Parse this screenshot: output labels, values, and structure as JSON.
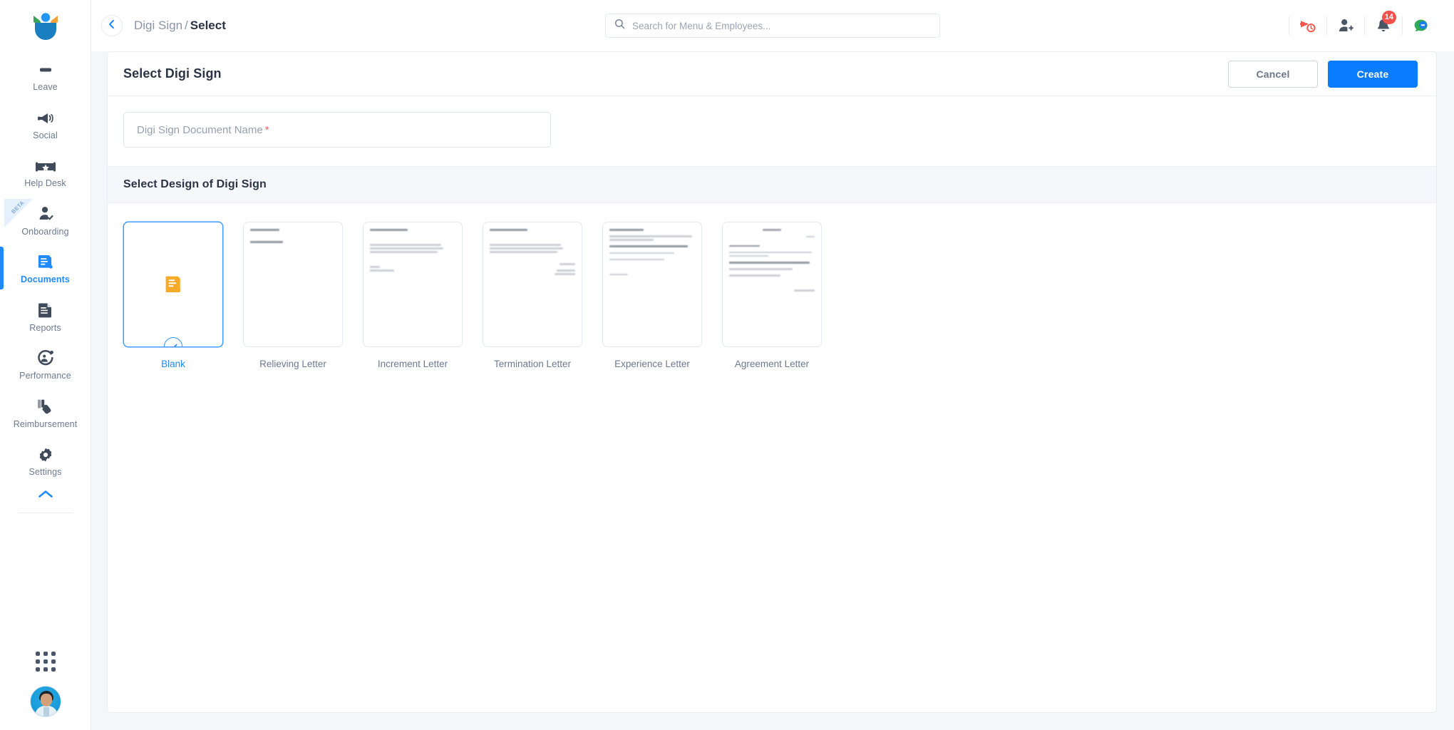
{
  "sidebar": {
    "logo_name": "company-logo",
    "items": [
      {
        "label": "Leave",
        "icon": "leave-icon",
        "active": false,
        "beta": false
      },
      {
        "label": "Social",
        "icon": "megaphone-icon",
        "active": false,
        "beta": false
      },
      {
        "label": "Help Desk",
        "icon": "help-desk-icon",
        "active": false,
        "beta": false
      },
      {
        "label": "Onboarding",
        "icon": "user-check-icon",
        "active": false,
        "beta": true
      },
      {
        "label": "Documents",
        "icon": "document-icon",
        "active": true,
        "beta": false
      },
      {
        "label": "Reports",
        "icon": "reports-icon",
        "active": false,
        "beta": false
      },
      {
        "label": "Performance",
        "icon": "performance-icon",
        "active": false,
        "beta": false
      },
      {
        "label": "Reimbursement",
        "icon": "reimbursement-icon",
        "active": false,
        "beta": false
      },
      {
        "label": "Settings",
        "icon": "gear-icon",
        "active": false,
        "beta": false
      }
    ],
    "beta_label": "BETA",
    "collapse_icon": "chevron-up-icon",
    "apps_icon": "grid-apps-icon",
    "avatar_icon": "user-avatar"
  },
  "topbar": {
    "back_icon": "chevron-left-icon",
    "breadcrumb": {
      "parent": "Digi Sign",
      "separator": "/",
      "current": "Select"
    },
    "search": {
      "icon": "search-icon",
      "placeholder": "Search for Menu & Employees...",
      "value": ""
    },
    "actions": [
      {
        "name": "announcement-clock-icon",
        "badge": null
      },
      {
        "name": "add-user-icon",
        "badge": null
      },
      {
        "name": "bell-icon",
        "badge": "14"
      },
      {
        "name": "chat-support-icon",
        "badge": null
      }
    ]
  },
  "panel": {
    "title": "Select Digi Sign",
    "cancel_label": "Cancel",
    "create_label": "Create",
    "field": {
      "placeholder": "Digi Sign Document Name",
      "required_mark": "*",
      "value": ""
    },
    "section_title": "Select Design of Digi Sign"
  },
  "designs": [
    {
      "label": "Blank",
      "selected": true,
      "preview": "blank"
    },
    {
      "label": "Relieving Letter",
      "selected": false,
      "preview": "relieving"
    },
    {
      "label": "Increment Letter",
      "selected": false,
      "preview": "increment"
    },
    {
      "label": "Termination Letter",
      "selected": false,
      "preview": "termination"
    },
    {
      "label": "Experience Letter",
      "selected": false,
      "preview": "experience"
    },
    {
      "label": "Agreement Letter",
      "selected": false,
      "preview": "agreement"
    }
  ],
  "colors": {
    "accent": "#1f8bff",
    "primary_button": "#0a7cff",
    "badge": "#f0524d",
    "blank_icon": "#f7a928",
    "text_dark": "#2b3445",
    "text_muted": "#6c7a90",
    "panel_bg": "#ffffff",
    "page_bg": "#f4f6fa"
  }
}
